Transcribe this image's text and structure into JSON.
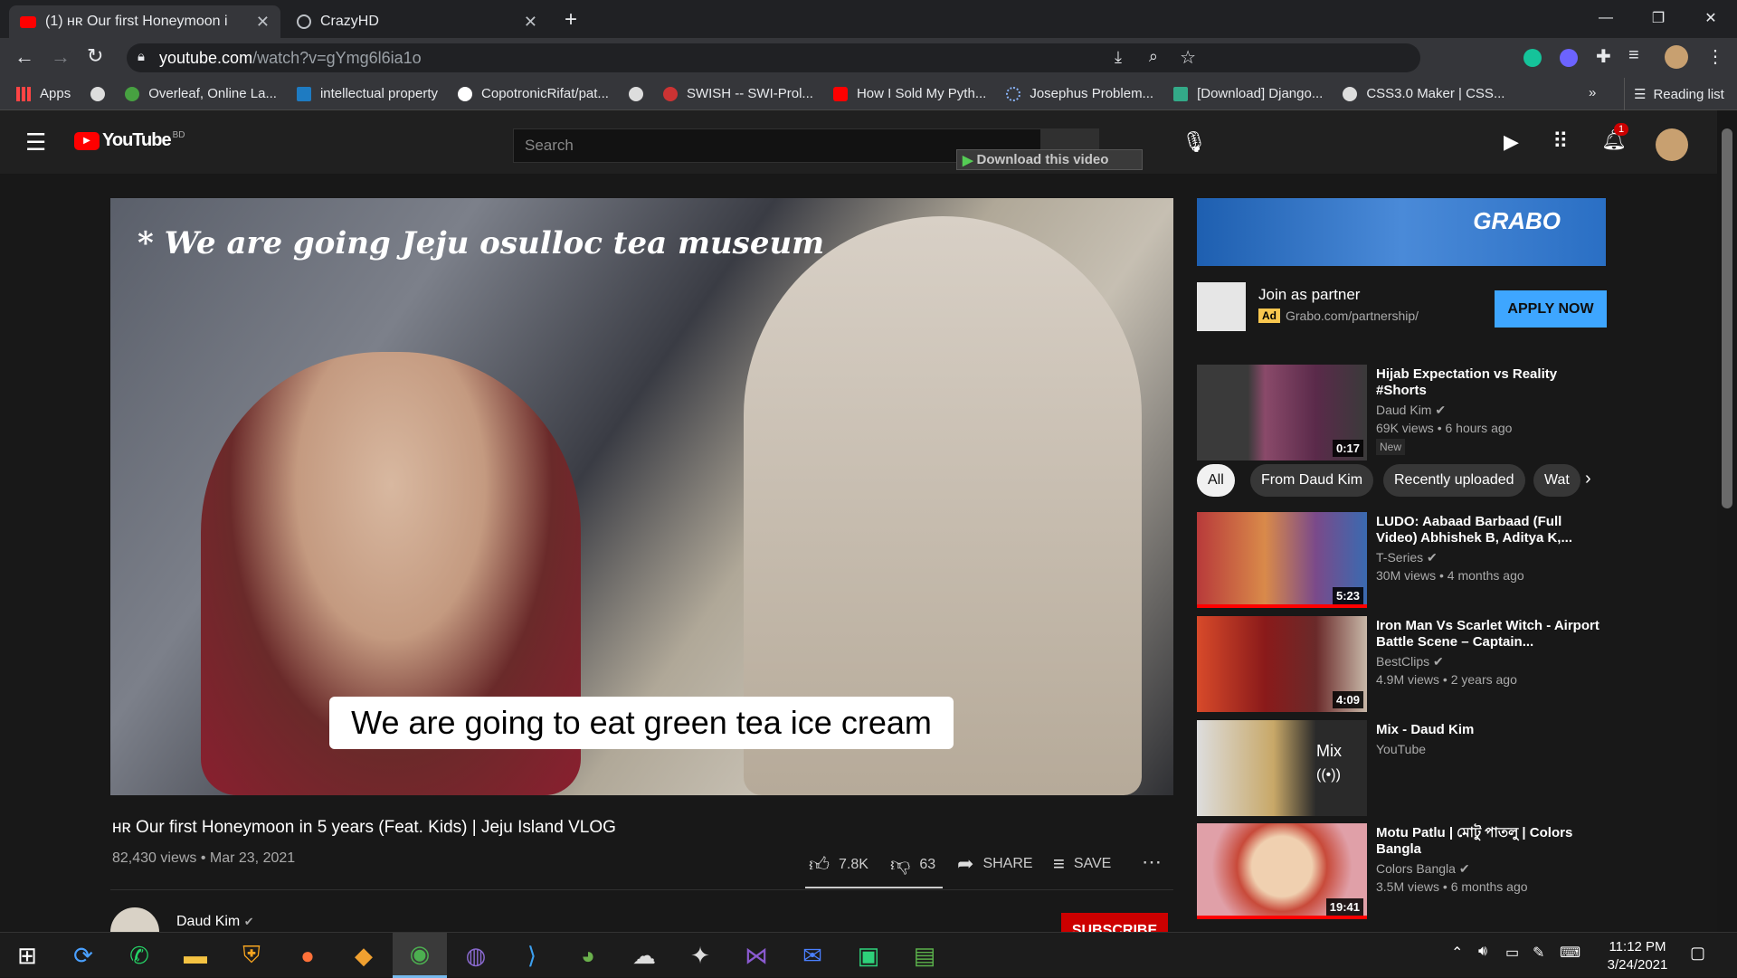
{
  "browser": {
    "tabs": [
      {
        "title": "(1) ʜʀ Our first Honeymoon i",
        "active": true
      },
      {
        "title": "CrazyHD",
        "active": false
      }
    ],
    "new_tab": "+",
    "url_host": "youtube.com",
    "url_path": "/watch?v=gYmg6l6ia1o",
    "bookmarks": [
      "Apps",
      "",
      "Overleaf, Online La...",
      "intellectual property",
      "CopotronicRifat/pat...",
      "",
      "SWISH -- SWI-Prol...",
      "How I Sold My Pyth...",
      "Josephus Problem...",
      "[Download] Django...",
      "CSS3.0 Maker | CSS..."
    ],
    "more": "»",
    "reading_list": "Reading list"
  },
  "youtube": {
    "logo": "YouTube",
    "region": "BD",
    "search_placeholder": "Search",
    "download_bar": "Download this video",
    "notif_count": "1",
    "video": {
      "overlay_text": "* We are going Jeju osulloc tea museum",
      "caption": "We are going to eat green tea ice cream",
      "title": "ʜʀ Our first Honeymoon in 5 years (Feat. Kids) | Jeju Island VLOG",
      "meta": "82,430 views • Mar 23, 2021",
      "likes": "7.8K",
      "dislikes": "63",
      "share": "SHARE",
      "save": "SAVE",
      "channel": "Daud Kim",
      "subscribe": "SUBSCRIBE"
    },
    "ad": {
      "brand": "GRABO",
      "title": "Join as partner",
      "badge": "Ad",
      "url": "Grabo.com/partnership/",
      "cta": "APPLY NOW"
    },
    "chips": [
      "All",
      "From Daud Kim",
      "Recently uploaded",
      "Wat"
    ],
    "recs": [
      {
        "title": "Hijab Expectation vs Reality #Shorts",
        "channel": "Daud Kim",
        "meta": "69K views • 6 hours ago",
        "duration": "0:17",
        "badge": "New"
      },
      {
        "title": "LUDO: Aabaad Barbaad (Full Video) Abhishek B, Aditya K,...",
        "channel": "T-Series",
        "meta": "30M views • 4 months ago",
        "duration": "5:23",
        "badge": ""
      },
      {
        "title": "Iron Man Vs Scarlet Witch - Airport Battle Scene – Captain...",
        "channel": "BestClips",
        "meta": "4.9M views • 2 years ago",
        "duration": "4:09",
        "badge": ""
      },
      {
        "title": "Mix - Daud Kim",
        "channel": "YouTube",
        "meta": "",
        "duration": "Mix",
        "badge": ""
      },
      {
        "title": "Motu Patlu | মোটু পাতলু | Colors Bangla",
        "channel": "Colors Bangla",
        "meta": "3.5M views • 6 months ago",
        "duration": "19:41",
        "badge": ""
      }
    ]
  },
  "taskbar": {
    "time": "11:12 PM",
    "date": "3/24/2021"
  }
}
